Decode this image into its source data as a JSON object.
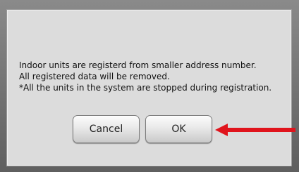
{
  "dialog": {
    "message_lines": [
      "Indoor units are registerd from smaller address number.",
      "All registered data will be removed.",
      "*All the units in the system are stopped during registration."
    ],
    "buttons": {
      "cancel_label": "Cancel",
      "ok_label": "OK"
    }
  },
  "annotation": {
    "arrow_icon": "red-arrow-left-icon",
    "color": "#e0141c"
  }
}
